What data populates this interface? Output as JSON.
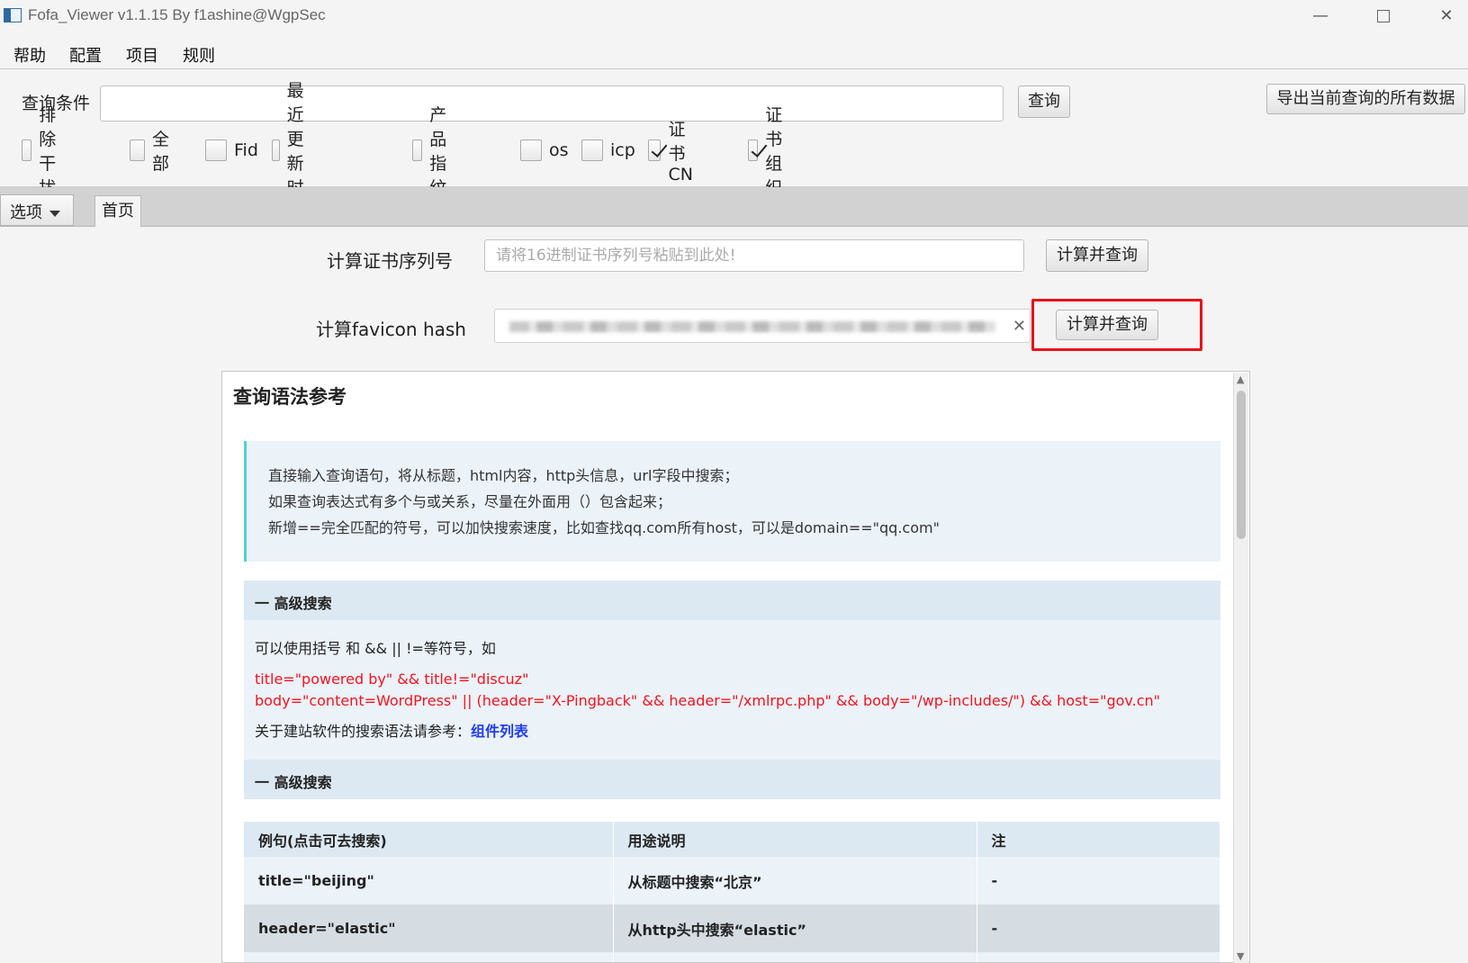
{
  "window": {
    "title": "Fofa_Viewer v1.1.15 By f1ashine@WgpSec",
    "minimize": "—",
    "close": "✕"
  },
  "menu": [
    "帮助",
    "配置",
    "项目",
    "规则"
  ],
  "query": {
    "label": "查询条件",
    "value": "",
    "query_button": "查询",
    "export_button": "导出当前查询的所有数据"
  },
  "checkboxes": [
    {
      "label": "排除干扰",
      "checked": false
    },
    {
      "label": "全部",
      "checked": false
    },
    {
      "label": "Fid",
      "checked": false
    },
    {
      "label": "最近更新时间",
      "checked": false
    },
    {
      "label": "产品指纹",
      "checked": false
    },
    {
      "label": "os",
      "checked": false
    },
    {
      "label": "icp",
      "checked": false
    },
    {
      "label": "证书CN",
      "checked": true
    },
    {
      "label": "证书组织",
      "checked": true
    }
  ],
  "tabs": {
    "options": "选项",
    "home": "首页"
  },
  "cert": {
    "label": "计算证书序列号",
    "placeholder": "请将16进制证书序列号粘贴到此处!",
    "button": "计算并查询"
  },
  "favicon": {
    "label": "计算favicon hash",
    "clear": "✕",
    "button": "计算并查询"
  },
  "reference": {
    "title": "查询语法参考",
    "intro": [
      "直接输入查询语句，将从标题，html内容，http头信息，url字段中搜索；",
      "如果查询表达式有多个与或关系，尽量在外面用（）包含起来；",
      "新增==完全匹配的符号，可以加快搜索速度，比如查找qq.com所有host，可以是domain==\"qq.com\""
    ],
    "section1": "一  高级搜索",
    "adv_text": "可以使用括号 和 && || !=等符号，如",
    "example1": "title=\"powered by\" && title!=\"discuz\"",
    "example2": "body=\"content=WordPress\" || (header=\"X-Pingback\" && header=\"/xmlrpc.php\" && body=\"/wp-includes/\") && host=\"gov.cn\"",
    "site_ref": "关于建站软件的搜索语法请参考：",
    "site_link": "组件列表",
    "section2": "一  高级搜索",
    "table": {
      "headers": [
        "例句(点击可去搜索)",
        "用途说明",
        "注"
      ],
      "rows": [
        [
          "title=\"beijing\"",
          "从标题中搜索“北京”",
          "-"
        ],
        [
          "header=\"elastic\"",
          "从http头中搜索“elastic”",
          "-"
        ]
      ]
    }
  }
}
